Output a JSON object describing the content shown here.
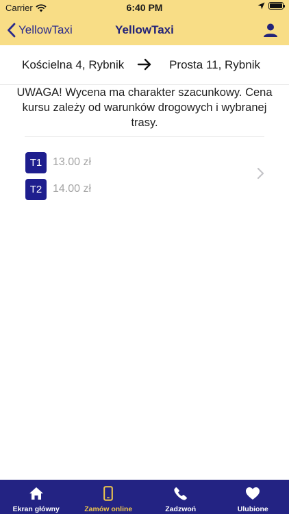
{
  "status_bar": {
    "carrier": "Carrier",
    "time": "6:40 PM"
  },
  "nav": {
    "back_label": "YellowTaxi",
    "title": "YellowTaxi"
  },
  "route": {
    "from": "Kościelna 4, Rybnik",
    "to": "Prosta 11, Rybnik"
  },
  "notice": "UWAGA! Wycena ma charakter szacunkowy. Cena kursu zależy od warunków drogowych i wybranej trasy.",
  "tariffs": [
    {
      "code": "T1",
      "price": "13.00 zł"
    },
    {
      "code": "T2",
      "price": "14.00 zł"
    }
  ],
  "tabs": [
    {
      "label": "Ekran główny",
      "icon": "home-icon"
    },
    {
      "label": "Zamów online",
      "icon": "phone-device-icon",
      "active": true
    },
    {
      "label": "Zadzwoń",
      "icon": "call-icon"
    },
    {
      "label": "Ulubione",
      "icon": "heart-icon"
    }
  ],
  "colors": {
    "header": "#f8dd86",
    "navy": "#232383",
    "active_tab": "#f2c94c",
    "badge": "#1e1e8e"
  }
}
